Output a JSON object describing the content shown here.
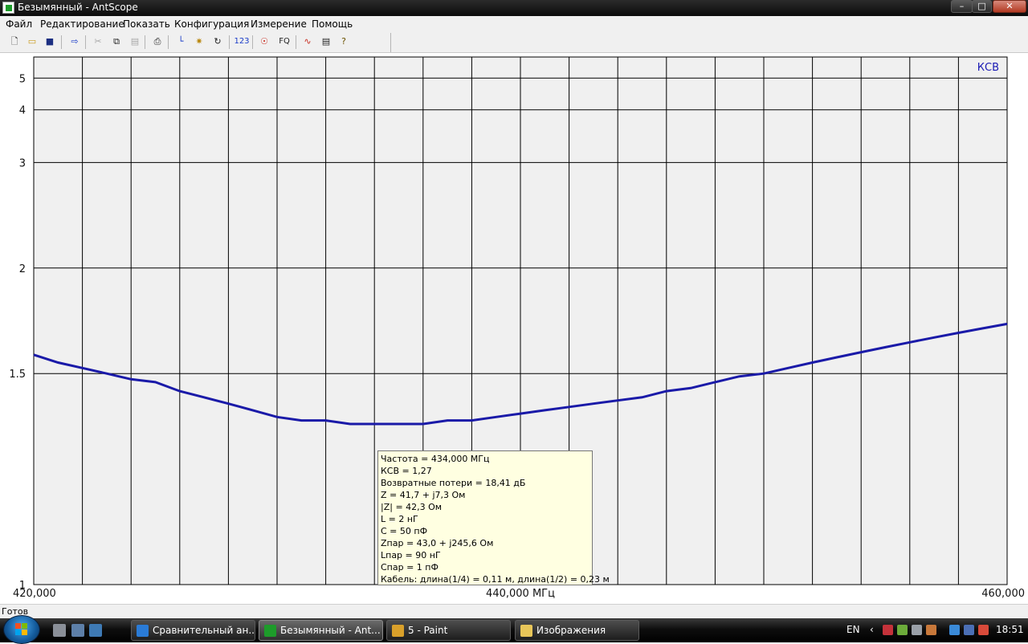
{
  "window": {
    "title": "Безымянный - AntScope"
  },
  "menu": [
    "Файл",
    "Редактирование",
    "Показать",
    "Конфигурация",
    "Измерение",
    "Помощь"
  ],
  "toolbar": {
    "numeric_label": "123",
    "fq_label": "FQ"
  },
  "chart_data": {
    "type": "line",
    "series": [
      {
        "name": "КСВ",
        "color": "#1a1aa8",
        "x": [
          420,
          421,
          422,
          423,
          424,
          425,
          426,
          427,
          428,
          429,
          430,
          431,
          432,
          433,
          434,
          435,
          436,
          437,
          438,
          439,
          440,
          441,
          442,
          443,
          444,
          445,
          446,
          447,
          448,
          449,
          450,
          451,
          452,
          453,
          454,
          455,
          456,
          457,
          458,
          459,
          460
        ],
        "y": [
          1.57,
          1.54,
          1.52,
          1.5,
          1.48,
          1.47,
          1.44,
          1.42,
          1.4,
          1.38,
          1.36,
          1.35,
          1.35,
          1.34,
          1.34,
          1.34,
          1.34,
          1.35,
          1.35,
          1.36,
          1.37,
          1.38,
          1.39,
          1.4,
          1.41,
          1.42,
          1.44,
          1.45,
          1.47,
          1.49,
          1.5,
          1.52,
          1.54,
          1.56,
          1.58,
          1.6,
          1.62,
          1.64,
          1.66,
          1.68,
          1.7
        ]
      }
    ],
    "y_ticks": [
      {
        "value": 1,
        "label": "1"
      },
      {
        "value": 1.5,
        "label": "1.5"
      },
      {
        "value": 2,
        "label": "2"
      },
      {
        "value": 3,
        "label": "3"
      },
      {
        "value": 4,
        "label": "4"
      },
      {
        "value": 5,
        "label": "5"
      }
    ],
    "x_tick_labels": [
      {
        "x": 420,
        "label": "420,000"
      },
      {
        "x": 440,
        "label": "440,000 МГц"
      },
      {
        "x": 460,
        "label": "460,000"
      }
    ],
    "xlim": [
      420,
      460
    ],
    "ylim": [
      1,
      6
    ],
    "y_scale": "reciprocal",
    "x_gridlines": 20,
    "grid": true,
    "legend": "top-right"
  },
  "marker_tooltip": {
    "lines": [
      "Частота = 434,000 МГц",
      "КСВ = 1,27",
      "Возвратные потери = 18,41 дБ",
      "Z = 41,7 + j7,3 Ом",
      "|Z| = 42,3 Ом",
      "L = 2 нГ",
      "C = 50 пФ",
      "Zпар = 43,0 + j245,6 Ом",
      "Lпар = 90 нГ",
      "Cпар = 1 пФ",
      "Кабель: длина(1/4) = 0,11 м, длина(1/2) = 0,23 м"
    ]
  },
  "status": {
    "text": "Готов"
  },
  "taskbar": {
    "tasks": [
      {
        "label": "Сравнительный ан...",
        "active": false
      },
      {
        "label": "Безымянный - Ant...",
        "active": true
      },
      {
        "label": "5 - Paint",
        "active": false
      },
      {
        "label": "Изображения",
        "active": false
      }
    ],
    "language": "EN",
    "clock": "18:51"
  }
}
